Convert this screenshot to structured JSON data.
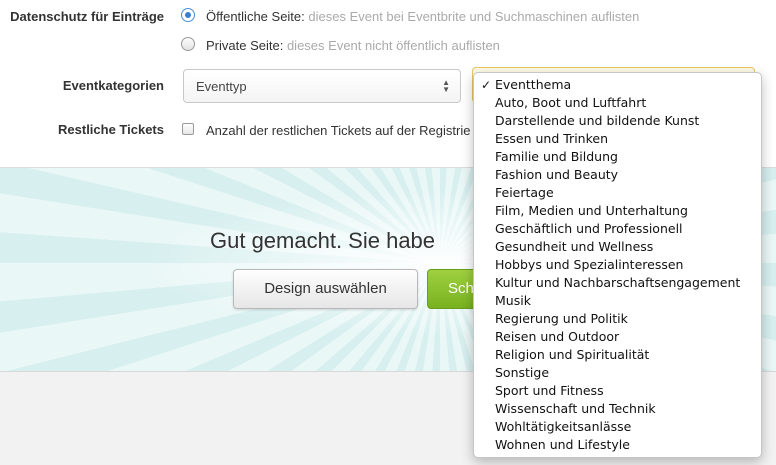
{
  "privacy": {
    "label": "Datenschutz für Einträge",
    "public_label": "Öffentliche Seite:",
    "public_desc": "dieses Event bei Eventbrite und Suchmaschinen auflisten",
    "private_label": "Private Seite:",
    "private_desc": "dieses Event nicht öffentlich auflisten"
  },
  "categories": {
    "label": "Eventkategorien",
    "type_value": "Eventtyp"
  },
  "tickets": {
    "label": "Restliche Tickets",
    "checkbox_text": "Anzahl der restlichen Tickets auf der Registrie"
  },
  "banner": {
    "title": "Gut gemacht. Sie habe",
    "design_button": "Design auswählen",
    "save_button": "Sch"
  },
  "dropdown": {
    "selected_check": "✓",
    "items": [
      "Eventthema",
      "Auto, Boot und Luftfahrt",
      "Darstellende und bildende Kunst",
      "Essen und Trinken",
      "Familie und Bildung",
      "Fashion und Beauty",
      "Feiertage",
      "Film, Medien und Unterhaltung",
      "Geschäftlich und Professionell",
      "Gesundheit und Wellness",
      "Hobbys und Spezialinteressen",
      "Kultur und Nachbarschaftsengagement",
      "Musik",
      "Regierung und Politik",
      "Reisen und Outdoor",
      "Religion und Spiritualität",
      "Sonstige",
      "Sport und Fitness",
      "Wissenschaft und Technik",
      "Wohltätigkeitsanlässe",
      "Wohnen und Lifestyle"
    ]
  },
  "colors": {
    "accent_blue": "#3b7fcf",
    "save_green": "#8cc333",
    "banner_teal": "#d7efef"
  }
}
